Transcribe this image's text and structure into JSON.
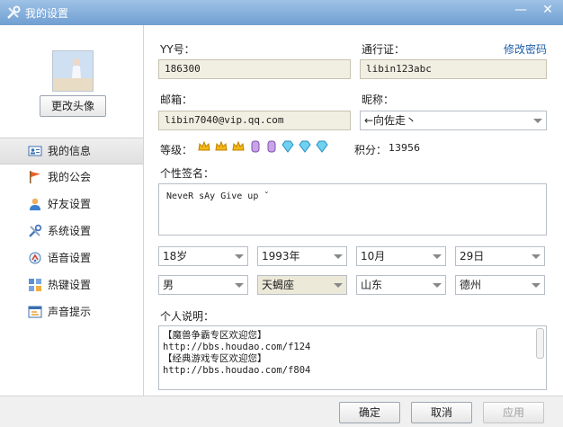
{
  "window": {
    "title": "我的设置",
    "minimize": "—",
    "close": "✕"
  },
  "sidebar": {
    "change_avatar": "更改头像",
    "items": [
      {
        "label": "我的信息",
        "icon": "profile-card-icon"
      },
      {
        "label": "我的公会",
        "icon": "flag-icon"
      },
      {
        "label": "好友设置",
        "icon": "friend-icon"
      },
      {
        "label": "系统设置",
        "icon": "tools-icon"
      },
      {
        "label": "语音设置",
        "icon": "voice-icon"
      },
      {
        "label": "热键设置",
        "icon": "hotkey-icon"
      },
      {
        "label": "声音提示",
        "icon": "sound-prompt-icon"
      }
    ]
  },
  "profile": {
    "yy_label": "YY号：",
    "yy_value": "186300",
    "passport_label": "通行证：",
    "passport_value": "libin123abc",
    "change_password": "修改密码",
    "email_label": "邮箱：",
    "email_value": "libin7040@vip.qq.com",
    "nickname_label": "昵称：",
    "nickname_value": "←向佐走丶",
    "level_label": "等级：",
    "points_label": "积分：",
    "points_value": "13956",
    "signature_label": "个性签名：",
    "signature_value": "NeveR sAy Give up ˇ",
    "age": "18岁",
    "birth_year": "1993年",
    "birth_month": "10月",
    "birth_day": "29日",
    "gender": "男",
    "zodiac": "天蝎座",
    "province": "山东",
    "city": "德州",
    "description_label": "个人说明：",
    "description_lines": [
      "【魔兽争霸专区欢迎您】",
      "http://bbs.houdao.com/f124",
      "【经典游戏专区欢迎您】",
      "http://bbs.houdao.com/f804"
    ]
  },
  "footer": {
    "ok": "确定",
    "cancel": "取消",
    "apply": "应用"
  }
}
